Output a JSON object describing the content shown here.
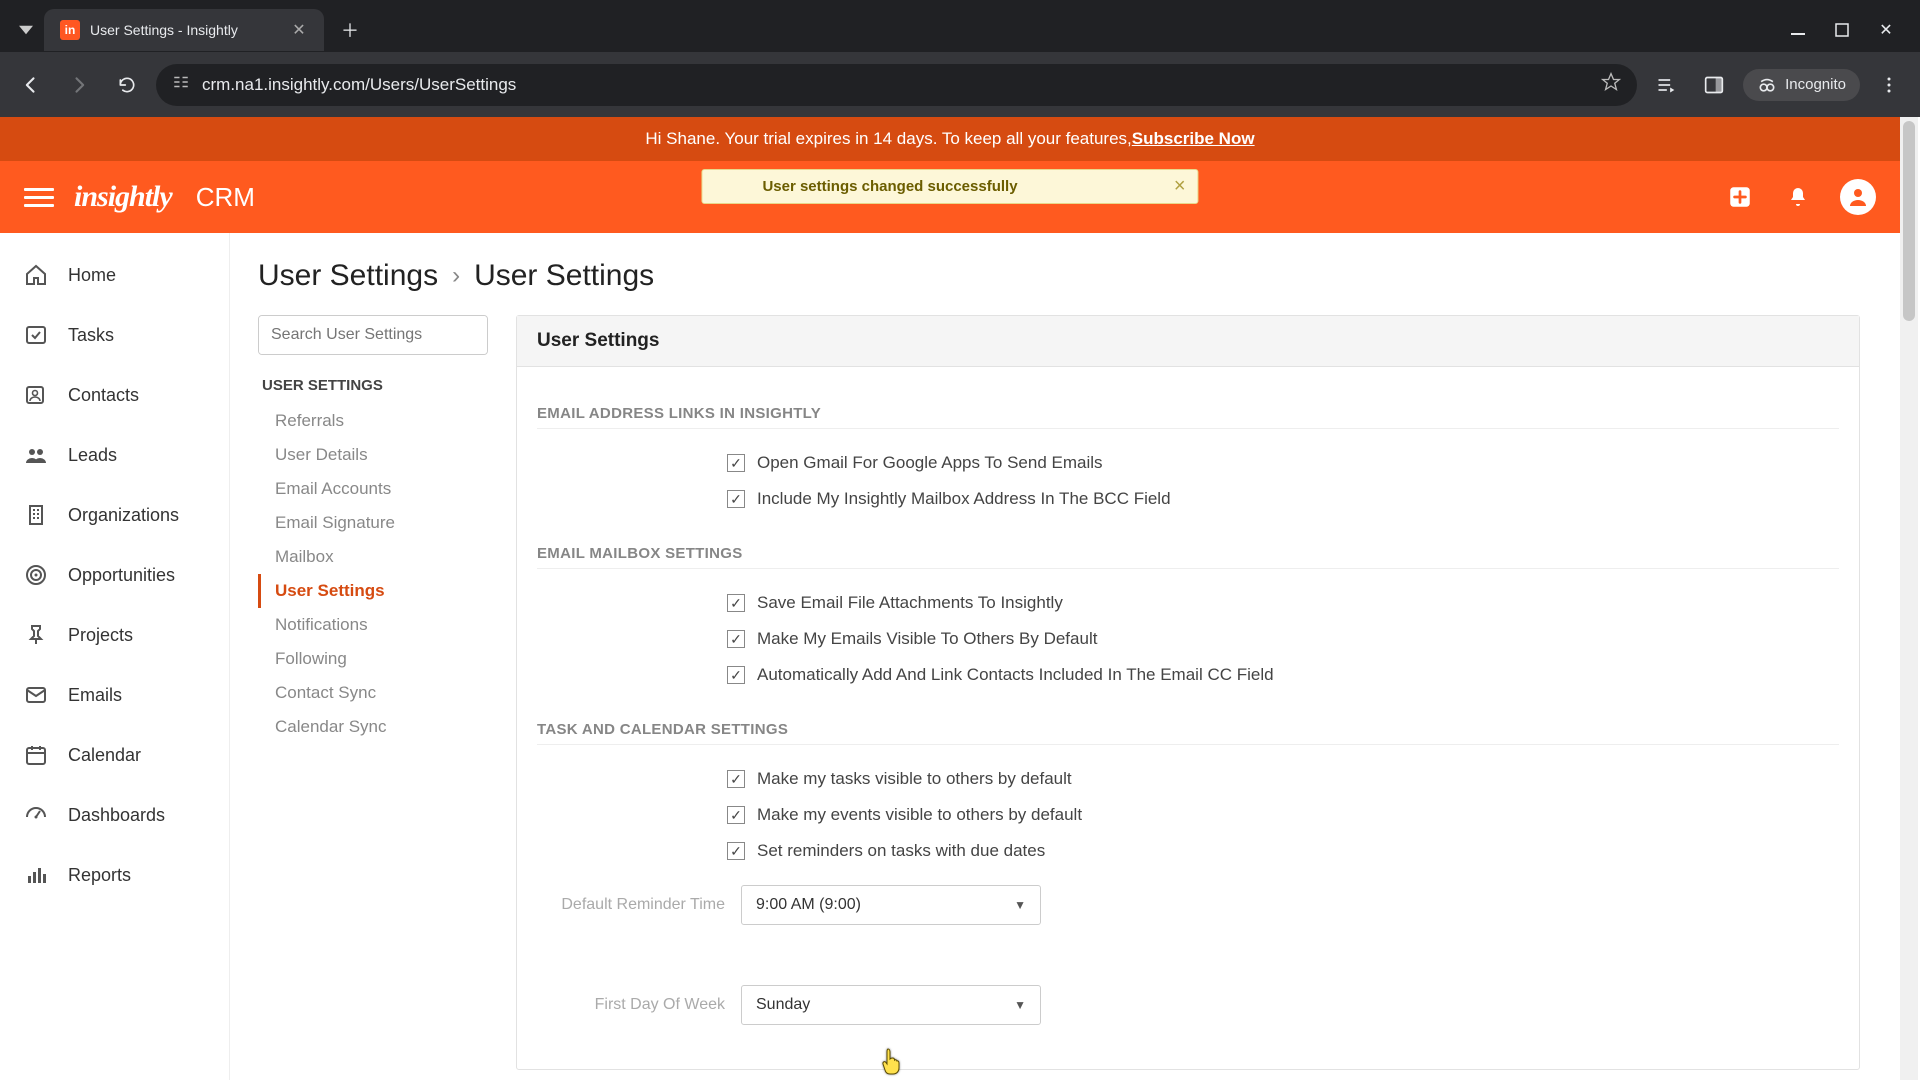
{
  "browser": {
    "tab_title": "User Settings - Insightly",
    "url": "crm.na1.insightly.com/Users/UserSettings",
    "incognito_label": "Incognito"
  },
  "trial_banner": {
    "text_prefix": "Hi Shane. Your trial expires in 14 days. To keep all your features, ",
    "link_text": "Subscribe Now"
  },
  "app_header": {
    "logo_text": "insightly",
    "product_label": "CRM",
    "toast_message": "User settings changed successfully"
  },
  "left_nav": {
    "items": [
      {
        "label": "Home"
      },
      {
        "label": "Tasks"
      },
      {
        "label": "Contacts"
      },
      {
        "label": "Leads"
      },
      {
        "label": "Organizations"
      },
      {
        "label": "Opportunities"
      },
      {
        "label": "Projects"
      },
      {
        "label": "Emails"
      },
      {
        "label": "Calendar"
      },
      {
        "label": "Dashboards"
      },
      {
        "label": "Reports"
      }
    ]
  },
  "breadcrumb": {
    "root": "User Settings",
    "separator": "›",
    "current": "User Settings"
  },
  "settings_sidebar": {
    "search_placeholder": "Search User Settings",
    "heading": "USER SETTINGS",
    "items": [
      {
        "label": "Referrals",
        "active": false
      },
      {
        "label": "User Details",
        "active": false
      },
      {
        "label": "Email Accounts",
        "active": false
      },
      {
        "label": "Email Signature",
        "active": false
      },
      {
        "label": "Mailbox",
        "active": false
      },
      {
        "label": "User Settings",
        "active": true
      },
      {
        "label": "Notifications",
        "active": false
      },
      {
        "label": "Following",
        "active": false
      },
      {
        "label": "Contact Sync",
        "active": false
      },
      {
        "label": "Calendar Sync",
        "active": false
      }
    ]
  },
  "panel": {
    "heading": "User Settings",
    "sections": {
      "email_links": {
        "title": "EMAIL ADDRESS LINKS IN INSIGHTLY",
        "checks": [
          {
            "label": "Open Gmail For Google Apps To Send Emails",
            "checked": true
          },
          {
            "label": "Include My Insightly Mailbox Address In The BCC Field",
            "checked": true
          }
        ]
      },
      "mailbox": {
        "title": "EMAIL MAILBOX SETTINGS",
        "checks": [
          {
            "label": "Save Email File Attachments To Insightly",
            "checked": true
          },
          {
            "label": "Make My Emails Visible To Others By Default",
            "checked": true
          },
          {
            "label": "Automatically Add And Link Contacts Included In The Email CC Field",
            "checked": true
          }
        ]
      },
      "task_cal": {
        "title": "TASK AND CALENDAR SETTINGS",
        "checks": [
          {
            "label": "Make my tasks visible to others by default",
            "checked": true
          },
          {
            "label": "Make my events visible to others by default",
            "checked": true
          },
          {
            "label": "Set reminders on tasks with due dates",
            "checked": true
          }
        ],
        "reminder_label": "Default Reminder Time",
        "reminder_value": "9:00 AM (9:00)",
        "first_day_label": "First Day Of Week",
        "first_day_value": "Sunday"
      }
    }
  }
}
